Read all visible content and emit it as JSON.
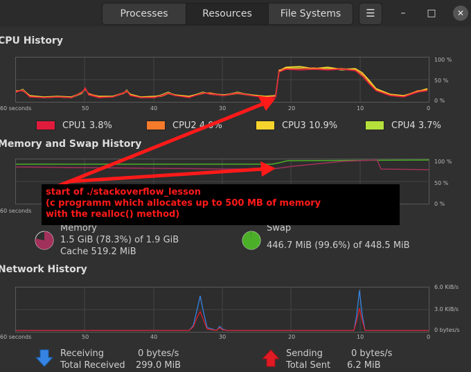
{
  "header": {
    "tabs": [
      {
        "label": "Processes",
        "active": false
      },
      {
        "label": "Resources",
        "active": true
      },
      {
        "label": "File Systems",
        "active": false
      }
    ],
    "menu_icon": "hamburger-menu-icon",
    "window_controls": {
      "minimize": "–",
      "maximize": "□",
      "close": "✕"
    }
  },
  "cpu": {
    "title": "CPU History",
    "x_ticks": [
      "60 seconds",
      "50",
      "40",
      "30",
      "20",
      "10",
      "0"
    ],
    "y_ticks": [
      "100 %",
      "50 %",
      "0 %"
    ],
    "legend": [
      {
        "label": "CPU1",
        "value": "3.8%",
        "color": "#e01b3c"
      },
      {
        "label": "CPU2",
        "value": "4.0%",
        "color": "#f57a2a"
      },
      {
        "label": "CPU3",
        "value": "10.9%",
        "color": "#f6d32d"
      },
      {
        "label": "CPU4",
        "value": "3.7%",
        "color": "#b5e03c"
      }
    ]
  },
  "memory": {
    "title": "Memory and Swap History",
    "x_ticks": [
      "60 seconds",
      "50",
      "40",
      "30",
      "20",
      "10",
      "0"
    ],
    "y_ticks": [
      "100 %",
      "50 %",
      "0 %"
    ],
    "memory_label": "Memory",
    "memory_usage": "1.5 GiB (78.3%) of 1.9 GiB",
    "memory_cache": "Cache 519.2 MiB",
    "memory_color": "#a2315a",
    "memory_fraction": 0.783,
    "swap_label": "Swap",
    "swap_usage": "446.7 MiB (99.6%) of 448.5 MiB",
    "swap_color": "#4caf28",
    "swap_fraction": 0.996
  },
  "network": {
    "title": "Network History",
    "x_ticks": [
      "60 seconds",
      "50",
      "40",
      "30",
      "20",
      "10",
      "0"
    ],
    "y_ticks": [
      "6.0 KiB/s",
      "3.0 KiB/s",
      "0 bytes/s"
    ],
    "receiving_label": "Receiving",
    "receiving_value": "0 bytes/s",
    "total_received_label": "Total Received",
    "total_received_value": "299.0 MiB",
    "sending_label": "Sending",
    "sending_value": "0 bytes/s",
    "total_sent_label": "Total Sent",
    "total_sent_value": "6.2 MiB",
    "receiving_color": "#3584e4",
    "sending_color": "#e01b24"
  },
  "annotation": {
    "line1": "start of ./stackoverflow_lesson",
    "line2": "(c programm which allocates up to 500 MB of memory",
    "line3": "with the realloc() method)",
    "color": "#ff1a1a"
  }
}
